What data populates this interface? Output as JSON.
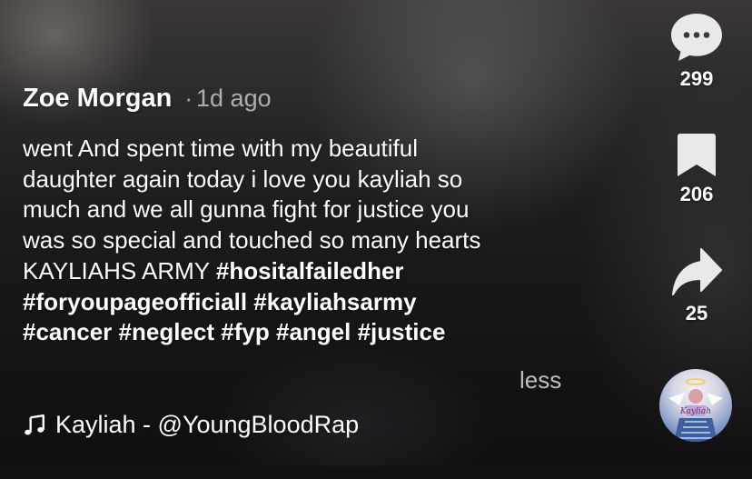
{
  "post": {
    "author": "Zoe Morgan",
    "separator": "·",
    "age": "1d ago",
    "description_lines": [
      "went And spent time with my beautiful",
      "daughter again today i love you kayliah so",
      "much and we all gunna fight for justice you",
      "was so special and touched so many hearts"
    ],
    "description_tail": "KAYLIAHS ARMY ",
    "hashtags": [
      "#hositalfailedher",
      "#foryoupageofficiall",
      "#kayliahsarmy",
      "#cancer",
      "#neglect",
      "#fyp",
      "#angel",
      "#justice"
    ],
    "less_label": "less"
  },
  "music": {
    "icon": "music-note-icon",
    "label": "Kayliah - @YoungBloodRap"
  },
  "actions": {
    "comments": {
      "icon": "comment-icon",
      "count": "299"
    },
    "saves": {
      "icon": "bookmark-icon",
      "count": "206"
    },
    "shares": {
      "icon": "share-icon",
      "count": "25"
    },
    "sound": {
      "icon": "sound-disc-icon",
      "disc_text": "Kayliah"
    }
  }
}
